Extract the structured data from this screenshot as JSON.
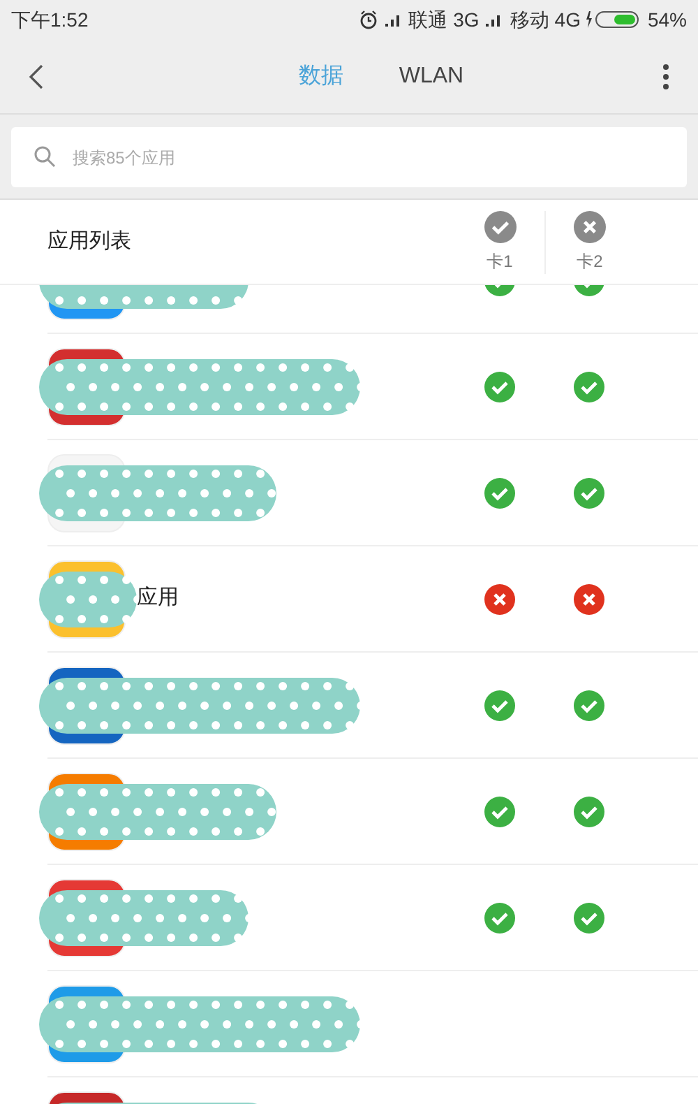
{
  "status_bar": {
    "time": "下午1:52",
    "carrier_1": "联通",
    "network_1": "3G",
    "carrier_2": "移动",
    "network_2": "4G",
    "battery": "54%"
  },
  "tabs": [
    {
      "label": "数据",
      "selected": true
    },
    {
      "label": "WLAN",
      "selected": false
    }
  ],
  "search": {
    "placeholder": "搜索85个应用"
  },
  "list_header": {
    "title": "应用列表",
    "columns": [
      {
        "label": "卡1",
        "kind": "check"
      },
      {
        "label": "卡2",
        "kind": "cross"
      }
    ]
  },
  "rows": [
    {
      "color": "#2196f3",
      "sim_1": true,
      "sim_2": true
    },
    {
      "color": "#d32f2f",
      "sim_1": true,
      "sim_2": true
    },
    {
      "color": "#f5f5f5",
      "sim_1": true,
      "sim_2": true
    },
    {
      "color": "#fbc02d",
      "name": "应用",
      "sim_1": false,
      "sim_2": false
    },
    {
      "color": "#1565c0",
      "sim_1": true,
      "sim_2": true
    },
    {
      "color": "#f57c00",
      "sim_1": true,
      "sim_2": true
    },
    {
      "color": "#e53935",
      "sim_1": true,
      "sim_2": true
    },
    {
      "color": "#1e9be8"
    },
    {
      "color": "#c62828"
    }
  ]
}
